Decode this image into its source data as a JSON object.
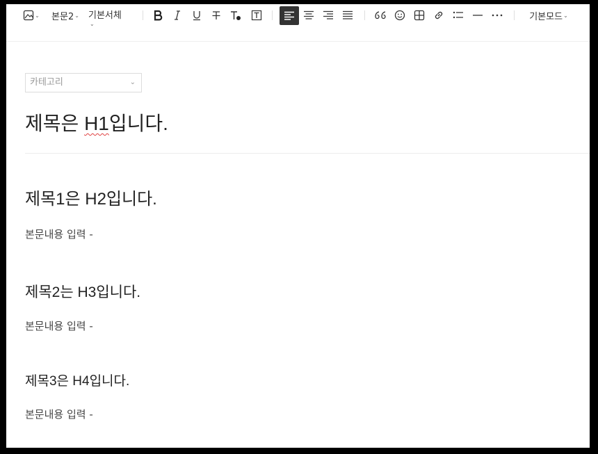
{
  "toolbar": {
    "paragraph_style": "본문2",
    "font_family": "기본서체",
    "mode": "기본모드",
    "caret": "⌄"
  },
  "document": {
    "category_placeholder": "카테고리",
    "title_prefix": "제목은 ",
    "title_misspelled": "H1",
    "title_suffix": "입니다.",
    "sections": [
      {
        "heading": "제목1은 H2입니다.",
        "body": "본문내용 입력 -"
      },
      {
        "heading": "제목2는 H3입니다.",
        "body": "본문내용 입력 -"
      },
      {
        "heading": "제목3은 H4입니다.",
        "body": "본문내용 입력 -"
      }
    ]
  },
  "colors": {
    "active_button": "#333333",
    "spellcheck_underline": "#e04040"
  }
}
